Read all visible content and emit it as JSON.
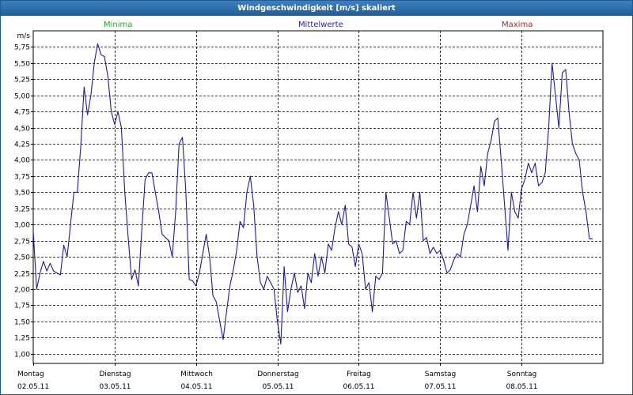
{
  "window": {
    "title": "Windgeschwindigkeit [m/s] skaliert"
  },
  "legend": [
    {
      "label": "Minima",
      "color": "#22aa22"
    },
    {
      "label": "Mittelwerte",
      "color": "#2020c0"
    },
    {
      "label": "Maxima",
      "color": "#c02020"
    }
  ],
  "chart_data": {
    "type": "line",
    "title": "Windgeschwindigkeit [m/s] skaliert",
    "ylabel": "m/s",
    "ylim": [
      0.85,
      6.0
    ],
    "grid": true,
    "y_ticks": [
      "1,00",
      "1,25",
      "1,50",
      "1,75",
      "2,00",
      "2,25",
      "2,50",
      "2,75",
      "3,00",
      "3,25",
      "3,50",
      "3,75",
      "4,00",
      "4,25",
      "4,50",
      "4,75",
      "5,00",
      "5,25",
      "5,50",
      "5,75"
    ],
    "y_tick_values": [
      1.0,
      1.25,
      1.5,
      1.75,
      2.0,
      2.25,
      2.5,
      2.75,
      3.0,
      3.25,
      3.5,
      3.75,
      4.0,
      4.25,
      4.5,
      4.75,
      5.0,
      5.25,
      5.5,
      5.75
    ],
    "xlim": [
      "2011-05-02 00:00",
      "2011-05-09 00:00"
    ],
    "x_days": [
      {
        "day": "Montag",
        "date": "02.05.11"
      },
      {
        "day": "Dienstag",
        "date": "03.05.11"
      },
      {
        "day": "Mittwoch",
        "date": "04.05.11"
      },
      {
        "day": "Donnerstag",
        "date": "05.05.11"
      },
      {
        "day": "Freitag",
        "date": "06.05.11"
      },
      {
        "day": "Samstag",
        "date": "07.05.11"
      },
      {
        "day": "Sonntag",
        "date": "08.05.11"
      }
    ],
    "series": [
      {
        "name": "Mittelwerte",
        "color": "#1a1ab0",
        "points": [
          [
            "2011-05-02 00:00",
            2.9
          ],
          [
            "2011-05-02 01:00",
            2.0
          ],
          [
            "2011-05-02 02:00",
            2.25
          ],
          [
            "2011-05-02 03:00",
            2.43
          ],
          [
            "2011-05-02 04:00",
            2.28
          ],
          [
            "2011-05-02 05:00",
            2.4
          ],
          [
            "2011-05-02 06:00",
            2.28
          ],
          [
            "2011-05-02 07:00",
            2.25
          ],
          [
            "2011-05-02 08:00",
            2.22
          ],
          [
            "2011-05-02 09:00",
            2.68
          ],
          [
            "2011-05-02 10:00",
            2.5
          ],
          [
            "2011-05-02 11:00",
            3.0
          ],
          [
            "2011-05-02 12:00",
            3.5
          ],
          [
            "2011-05-02 13:00",
            3.5
          ],
          [
            "2011-05-02 14:00",
            4.2
          ],
          [
            "2011-05-02 15:00",
            5.13
          ],
          [
            "2011-05-02 16:00",
            4.7
          ],
          [
            "2011-05-02 17:00",
            5.0
          ],
          [
            "2011-05-02 18:00",
            5.5
          ],
          [
            "2011-05-02 19:00",
            5.8
          ],
          [
            "2011-05-02 20:00",
            5.63
          ],
          [
            "2011-05-02 21:00",
            5.6
          ],
          [
            "2011-05-02 22:00",
            5.3
          ],
          [
            "2011-05-02 23:00",
            4.75
          ],
          [
            "2011-05-03 00:00",
            4.55
          ],
          [
            "2011-05-03 01:00",
            4.75
          ],
          [
            "2011-05-03 02:00",
            4.5
          ],
          [
            "2011-05-03 03:00",
            3.5
          ],
          [
            "2011-05-03 04:00",
            2.8
          ],
          [
            "2011-05-03 05:00",
            2.15
          ],
          [
            "2011-05-03 06:00",
            2.3
          ],
          [
            "2011-05-03 07:00",
            2.05
          ],
          [
            "2011-05-03 08:00",
            2.9
          ],
          [
            "2011-05-03 09:00",
            3.7
          ],
          [
            "2011-05-03 10:00",
            3.8
          ],
          [
            "2011-05-03 11:00",
            3.8
          ],
          [
            "2011-05-03 12:00",
            3.5
          ],
          [
            "2011-05-03 13:00",
            3.2
          ],
          [
            "2011-05-03 14:00",
            2.85
          ],
          [
            "2011-05-03 15:00",
            2.8
          ],
          [
            "2011-05-03 16:00",
            2.75
          ],
          [
            "2011-05-03 17:00",
            2.5
          ],
          [
            "2011-05-03 18:00",
            3.2
          ],
          [
            "2011-05-03 19:00",
            4.25
          ],
          [
            "2011-05-03 20:00",
            4.35
          ],
          [
            "2011-05-03 21:00",
            3.5
          ],
          [
            "2011-05-03 22:00",
            2.15
          ],
          [
            "2011-05-03 23:00",
            2.13
          ],
          [
            "2011-05-04 00:00",
            2.05
          ],
          [
            "2011-05-04 01:00",
            2.25
          ],
          [
            "2011-05-04 02:00",
            2.55
          ],
          [
            "2011-05-04 03:00",
            2.85
          ],
          [
            "2011-05-04 04:00",
            2.5
          ],
          [
            "2011-05-04 05:00",
            1.9
          ],
          [
            "2011-05-04 06:00",
            1.8
          ],
          [
            "2011-05-04 07:00",
            1.5
          ],
          [
            "2011-05-04 08:00",
            1.22
          ],
          [
            "2011-05-04 09:00",
            1.65
          ],
          [
            "2011-05-04 10:00",
            2.05
          ],
          [
            "2011-05-04 11:00",
            2.3
          ],
          [
            "2011-05-04 12:00",
            2.6
          ],
          [
            "2011-05-04 13:00",
            3.05
          ],
          [
            "2011-05-04 14:00",
            2.95
          ],
          [
            "2011-05-04 15:00",
            3.5
          ],
          [
            "2011-05-04 16:00",
            3.75
          ],
          [
            "2011-05-04 17:00",
            3.3
          ],
          [
            "2011-05-04 18:00",
            2.5
          ],
          [
            "2011-05-04 19:00",
            2.1
          ],
          [
            "2011-05-04 20:00",
            2.0
          ],
          [
            "2011-05-04 21:00",
            2.2
          ],
          [
            "2011-05-04 22:00",
            2.1
          ],
          [
            "2011-05-04 23:00",
            2.0
          ],
          [
            "2011-05-05 00:00",
            1.5
          ],
          [
            "2011-05-05 01:00",
            1.15
          ],
          [
            "2011-05-05 02:00",
            2.35
          ],
          [
            "2011-05-05 03:00",
            1.65
          ],
          [
            "2011-05-05 04:00",
            2.0
          ],
          [
            "2011-05-05 05:00",
            2.25
          ],
          [
            "2011-05-05 06:00",
            1.95
          ],
          [
            "2011-05-05 07:00",
            2.05
          ],
          [
            "2011-05-05 08:00",
            1.7
          ],
          [
            "2011-05-05 09:00",
            2.25
          ],
          [
            "2011-05-05 10:00",
            2.1
          ],
          [
            "2011-05-05 11:00",
            2.55
          ],
          [
            "2011-05-05 12:00",
            2.2
          ],
          [
            "2011-05-05 13:00",
            2.5
          ],
          [
            "2011-05-05 14:00",
            2.25
          ],
          [
            "2011-05-05 15:00",
            2.7
          ],
          [
            "2011-05-05 16:00",
            2.6
          ],
          [
            "2011-05-05 17:00",
            2.95
          ],
          [
            "2011-05-05 18:00",
            3.2
          ],
          [
            "2011-05-05 19:00",
            3.0
          ],
          [
            "2011-05-05 20:00",
            3.3
          ],
          [
            "2011-05-05 21:00",
            2.7
          ],
          [
            "2011-05-05 22:00",
            2.65
          ],
          [
            "2011-05-05 23:00",
            2.35
          ],
          [
            "2011-05-06 00:00",
            2.7
          ],
          [
            "2011-05-06 01:00",
            2.55
          ],
          [
            "2011-05-06 02:00",
            2.0
          ],
          [
            "2011-05-06 03:00",
            2.1
          ],
          [
            "2011-05-06 04:00",
            1.65
          ],
          [
            "2011-05-06 05:00",
            2.2
          ],
          [
            "2011-05-06 06:00",
            2.15
          ],
          [
            "2011-05-06 07:00",
            2.25
          ],
          [
            "2011-05-06 08:00",
            3.5
          ],
          [
            "2011-05-06 09:00",
            3.1
          ],
          [
            "2011-05-06 10:00",
            2.7
          ],
          [
            "2011-05-06 11:00",
            2.75
          ],
          [
            "2011-05-06 12:00",
            2.55
          ],
          [
            "2011-05-06 13:00",
            2.6
          ],
          [
            "2011-05-06 14:00",
            3.05
          ],
          [
            "2011-05-06 15:00",
            3.0
          ],
          [
            "2011-05-06 16:00",
            3.5
          ],
          [
            "2011-05-06 17:00",
            3.1
          ],
          [
            "2011-05-06 18:00",
            3.5
          ],
          [
            "2011-05-06 19:00",
            2.75
          ],
          [
            "2011-05-06 20:00",
            2.8
          ],
          [
            "2011-05-06 21:00",
            2.55
          ],
          [
            "2011-05-06 22:00",
            2.65
          ],
          [
            "2011-05-06 23:00",
            2.55
          ],
          [
            "2011-05-07 00:00",
            2.6
          ],
          [
            "2011-05-07 01:00",
            2.45
          ],
          [
            "2011-05-07 02:00",
            2.25
          ],
          [
            "2011-05-07 03:00",
            2.3
          ],
          [
            "2011-05-07 04:00",
            2.45
          ],
          [
            "2011-05-07 05:00",
            2.55
          ],
          [
            "2011-05-07 06:00",
            2.5
          ],
          [
            "2011-05-07 07:00",
            2.85
          ],
          [
            "2011-05-07 08:00",
            3.0
          ],
          [
            "2011-05-07 09:00",
            3.3
          ],
          [
            "2011-05-07 10:00",
            3.6
          ],
          [
            "2011-05-07 11:00",
            3.2
          ],
          [
            "2011-05-07 12:00",
            3.9
          ],
          [
            "2011-05-07 13:00",
            3.6
          ],
          [
            "2011-05-07 14:00",
            4.1
          ],
          [
            "2011-05-07 15:00",
            4.3
          ],
          [
            "2011-05-07 16:00",
            4.6
          ],
          [
            "2011-05-07 17:00",
            4.65
          ],
          [
            "2011-05-07 18:00",
            4.0
          ],
          [
            "2011-05-07 19:00",
            3.3
          ],
          [
            "2011-05-07 20:00",
            2.6
          ],
          [
            "2011-05-07 21:00",
            3.5
          ],
          [
            "2011-05-07 22:00",
            3.2
          ],
          [
            "2011-05-07 23:00",
            3.1
          ],
          [
            "2011-05-08 00:00",
            3.55
          ],
          [
            "2011-05-08 01:00",
            3.7
          ],
          [
            "2011-05-08 02:00",
            3.95
          ],
          [
            "2011-05-08 03:00",
            3.8
          ],
          [
            "2011-05-08 04:00",
            3.95
          ],
          [
            "2011-05-08 05:00",
            3.6
          ],
          [
            "2011-05-08 06:00",
            3.65
          ],
          [
            "2011-05-08 07:00",
            3.8
          ],
          [
            "2011-05-08 08:00",
            4.5
          ],
          [
            "2011-05-08 09:00",
            5.5
          ],
          [
            "2011-05-08 10:00",
            5.0
          ],
          [
            "2011-05-08 11:00",
            4.5
          ],
          [
            "2011-05-08 12:00",
            5.35
          ],
          [
            "2011-05-08 13:00",
            5.4
          ],
          [
            "2011-05-08 14:00",
            4.75
          ],
          [
            "2011-05-08 15:00",
            4.25
          ],
          [
            "2011-05-08 16:00",
            4.1
          ],
          [
            "2011-05-08 17:00",
            4.0
          ],
          [
            "2011-05-08 18:00",
            3.5
          ],
          [
            "2011-05-08 19:00",
            3.2
          ],
          [
            "2011-05-08 20:00",
            2.78
          ],
          [
            "2011-05-08 21:00",
            2.78
          ]
        ]
      }
    ]
  }
}
